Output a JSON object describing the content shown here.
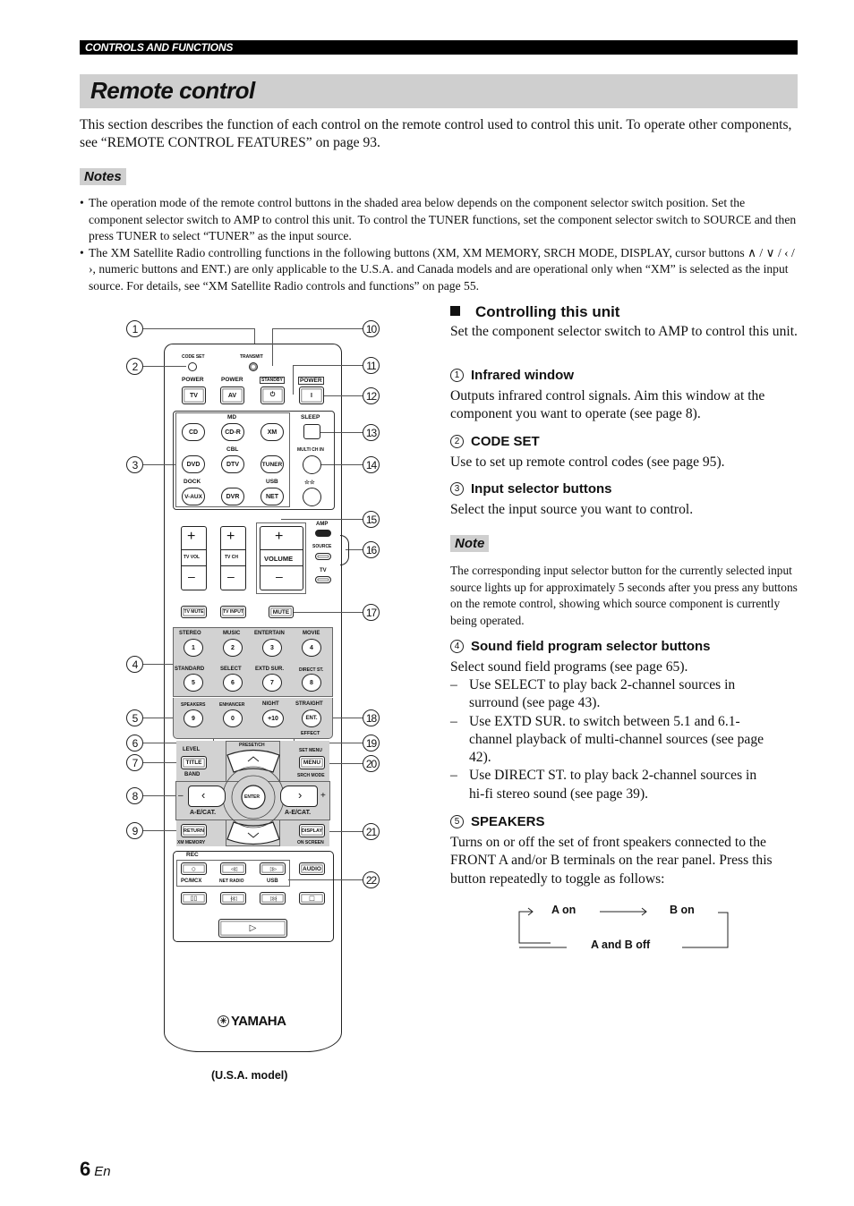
{
  "header": {
    "section": "CONTROLS AND FUNCTIONS",
    "title": "Remote control"
  },
  "intro": "This section describes the function of each control on the remote control used to control this unit. To operate other components, see “REMOTE CONTROL FEATURES” on page 93.",
  "notes": {
    "label": "Notes",
    "items": [
      "The operation mode of the remote control buttons in the shaded area below depends on the component selector switch position. Set the component selector switch to AMP to control this unit. To control the TUNER functions, set the component selector switch to SOURCE and then press TUNER to select “TUNER” as the input source.",
      "The XM Satellite Radio controlling functions in the following buttons (XM, XM MEMORY, SRCH MODE, DISPLAY, cursor buttons ∧ / ∨ / ‹ / ›, numeric buttons and ENT.) are only applicable to the U.S.A. and Canada models and are operational only when “XM” is selected as the input source. For details, see “XM Satellite Radio controls and functions” on page 55."
    ]
  },
  "section": {
    "title": "Controlling this unit",
    "intro": "Set the component selector switch to AMP to control this unit.",
    "items": [
      {
        "num": "1",
        "title": "Infrared window",
        "text": "Outputs infrared control signals. Aim this window at the component you want to operate (see page 8)."
      },
      {
        "num": "2",
        "title": "CODE SET",
        "text": "Use to set up remote control codes (see page 95)."
      },
      {
        "num": "3",
        "title": "Input selector buttons",
        "text": "Select the input source you want to control."
      },
      {
        "num": "4",
        "title": "Sound field program selector buttons",
        "text": "Select sound field programs (see page 65)."
      },
      {
        "num": "5",
        "title": "SPEAKERS",
        "text": "Turns on or off the set of front speakers connected to the FRONT A and/or B terminals on the rear panel. Press this button repeatedly to toggle as follows:"
      }
    ],
    "note": {
      "label": "Note",
      "text": "The corresponding input selector button for the currently selected input source lights up for approximately 5 seconds after you press any buttons on the remote control, showing which source component is currently being operated."
    },
    "sound_field_bullets": [
      "Use SELECT to play back 2-channel sources in surround (see page 43).",
      "Use EXTD SUR. to switch between 5.1 and 6.1-channel playback of multi-channel sources (see page 42).",
      "Use DIRECT ST. to play back 2-channel sources in hi-fi stereo sound (see page 39)."
    ],
    "speakers_cycle": {
      "a_on": "A on",
      "b_on": "B on",
      "off": "A and B off"
    }
  },
  "remote": {
    "caption": "(U.S.A. model)",
    "brand": "YAMAHA",
    "code_set": "CODE SET",
    "transmit": "TRANSMIT",
    "power_tv_lbl": "POWER",
    "power_tv": "TV",
    "power_av_lbl": "POWER",
    "power_av": "AV",
    "standby_lbl": "STANDBY",
    "standby": "⏻",
    "power_lbl": "POWER",
    "power": "I",
    "md": "MD",
    "cbl": "CBL",
    "dock": "DOCK",
    "usb": "USB",
    "inputs": [
      "CD",
      "CD-R",
      "XM",
      "DVD",
      "DTV",
      "TUNER",
      "V-AUX",
      "DVR",
      "NET"
    ],
    "sleep": "SLEEP",
    "multi_ch_in": "MULTI CH IN",
    "stars": "☆☆",
    "tv_vol": "TV VOL",
    "tv_ch": "TV CH",
    "volume": "VOLUME",
    "plus": "+",
    "minus": "–",
    "amp": "AMP",
    "source": "SOURCE",
    "tv": "TV",
    "tv_mute": "TV MUTE",
    "tv_input": "TV INPUT",
    "mute": "MUTE",
    "sound_labels": [
      "STEREO",
      "MUSIC",
      "ENTERTAIN",
      "MOVIE",
      "STANDARD",
      "SELECT",
      "EXTD SUR.",
      "DIRECT ST.",
      "SPEAKERS",
      "ENHANCER",
      "NIGHT",
      "STRAIGHT"
    ],
    "numbers": [
      "1",
      "2",
      "3",
      "4",
      "5",
      "6",
      "7",
      "8",
      "9",
      "0",
      "+10",
      "ENT."
    ],
    "effect": "EFFECT",
    "level": "LEVEL",
    "title": "TITLE",
    "band": "BAND",
    "preset_ch": "PRESET/CH",
    "set_menu": "SET MENU",
    "menu": "MENU",
    "srch_mode": "SRCH MODE",
    "enter": "ENTER",
    "aecat_left": "A-E/CAT.",
    "aecat_right": "A-E/CAT.",
    "return": "RETURN",
    "xm_memory": "XM MEMORY",
    "display": "DISPLAY",
    "on_screen": "ON SCREEN",
    "rec": "REC",
    "pc_mcx": "PC/MCX",
    "net_radio": "NET RADIO",
    "usb2": "USB",
    "audio": "AUDIO",
    "transport_row1": [
      "○",
      "◁◁",
      "▷▷"
    ],
    "transport_row2": [
      "▯▯",
      "|◁◁",
      "▷▷|",
      "□"
    ],
    "play": "▷",
    "callouts": [
      "1",
      "2",
      "3",
      "4",
      "5",
      "6",
      "7",
      "8",
      "9",
      "10",
      "11",
      "12",
      "13",
      "14",
      "15",
      "16",
      "17",
      "18",
      "19",
      "20",
      "21",
      "22"
    ]
  },
  "footer": {
    "page": "6",
    "lang": "En"
  }
}
